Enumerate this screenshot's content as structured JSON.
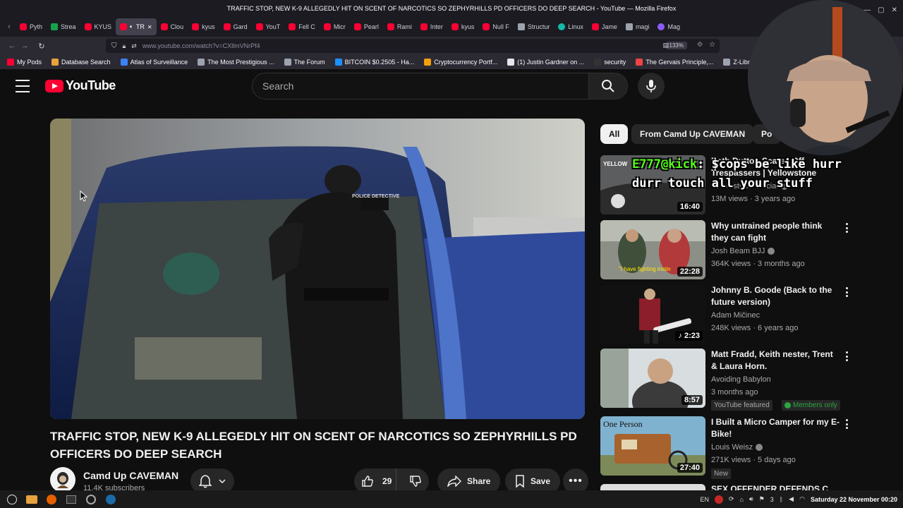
{
  "window": {
    "title": "TRAFFIC STOP, NEW K-9 ALLEGEDLY HIT ON SCENT OF NARCOTICS SO ZEPHYRHILLS PD OFFICERS DO DEEP SEARCH - YouTube — Mozilla Firefox"
  },
  "tabs": [
    {
      "label": "Pyth",
      "icon": "yt"
    },
    {
      "label": "Strea",
      "icon": "green"
    },
    {
      "label": "KYUS",
      "icon": "yt"
    },
    {
      "label": "TR",
      "icon": "yt",
      "active": true
    },
    {
      "label": "Clou",
      "icon": "yt"
    },
    {
      "label": "kyus",
      "icon": "yt"
    },
    {
      "label": "Gard",
      "icon": "yt"
    },
    {
      "label": "YouT",
      "icon": "yt"
    },
    {
      "label": "Fell C",
      "icon": "yt"
    },
    {
      "label": "Micr",
      "icon": "yt"
    },
    {
      "label": "Pearl",
      "icon": "yt"
    },
    {
      "label": "Rami",
      "icon": "yt"
    },
    {
      "label": "Inter",
      "icon": "yt"
    },
    {
      "label": "kyus",
      "icon": "yt"
    },
    {
      "label": "Null F",
      "icon": "yt"
    },
    {
      "label": "Structur",
      "icon": "gray"
    },
    {
      "label": "Linux",
      "icon": "teal"
    },
    {
      "label": "Jame",
      "icon": "yt"
    },
    {
      "label": "magi",
      "icon": "gray"
    },
    {
      "label": "Mag",
      "icon": "purple"
    }
  ],
  "urlbar": {
    "url": "www.youtube.com/watch?v=CXllmVNrPf4",
    "zoom": "133%"
  },
  "bookmarks": [
    "My Pods",
    "Database Search",
    "Atlas of Surveillance",
    "The Most Prestigious ...",
    "The Forum",
    "BITCOIN $0.2505 - Ha...",
    "Cryptocurrency Portf...",
    "(1) Justin Gardner on ...",
    "security",
    "The Gervais Principle,...",
    "Z-Library – the world'"
  ],
  "youtube": {
    "logo_text": "YouTube",
    "search_placeholder": "Search"
  },
  "video": {
    "title": "TRAFFIC STOP, NEW K-9 ALLEGEDLY HIT ON SCENT OF NARCOTICS SO ZEPHYRHILLS PD OFFICERS DO DEEP SEARCH",
    "channel": "Camd Up CAVEMAN",
    "subscribers": "11.4K subscribers",
    "likes": "29",
    "share_label": "Share",
    "save_label": "Save",
    "officer_vest_text": "POLICE DETECTIVE"
  },
  "chips": [
    "All",
    "From Camd Up CAVEMAN",
    "Po"
  ],
  "recommendations": [
    {
      "title": "Beth Dutton Scares Off Trespassers | Yellowstone",
      "channel": "Yellowstone Official",
      "views": "13M views",
      "age": "3 years ago",
      "duration": "16:40",
      "thumb_tag": "YELLOW"
    },
    {
      "title": "Why untrained people think they can fight",
      "channel": "Josh Beam BJJ",
      "views": "364K views",
      "age": "3 months ago",
      "duration": "22:28",
      "thumb_caption": "\"I have fighting instin"
    },
    {
      "title": "Johnny B. Goode (Back to the future version)",
      "channel": "Adam Mičinec",
      "views": "248K views",
      "age": "6 years ago",
      "duration": "2:23"
    },
    {
      "title": "Matt Fradd, Keith nester, Trent & Laura Horn.",
      "channel": "Avoiding Babylon",
      "age_line": "3 months ago",
      "duration": "8:57",
      "badge1": "YouTube featured",
      "badge2": "Members only"
    },
    {
      "title": "I Built a Micro Camper for my E-Bike!",
      "channel": "Louis Weisz",
      "views": "271K views",
      "age": "5 days ago",
      "duration": "27:40",
      "badge1": "New",
      "thumb_text": "One Person"
    },
    {
      "title": "SEX OFFENDER DEFENDS C"
    }
  ],
  "stream_overlay": {
    "kick": "E777@kick",
    "line1_rest": ": $cops be like hurr",
    "line2": "durr touch all your stuff"
  },
  "taskbar": {
    "lang": "EN",
    "clock": "Saturday 22 November 00:20",
    "notif_count": "3"
  }
}
